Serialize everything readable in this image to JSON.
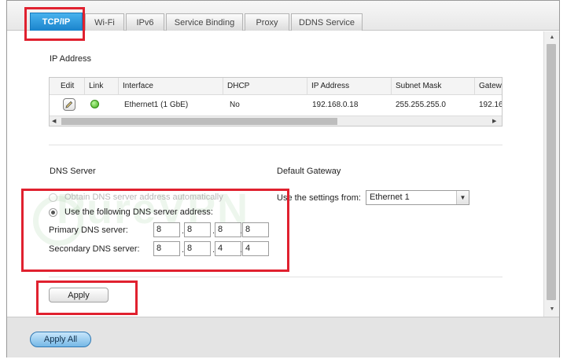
{
  "tabs": [
    {
      "label": "TCP/IP",
      "active": true
    },
    {
      "label": "Wi-Fi",
      "active": false
    },
    {
      "label": "IPv6",
      "active": false
    },
    {
      "label": "Service Binding",
      "active": false
    },
    {
      "label": "Proxy",
      "active": false
    },
    {
      "label": "DDNS Service",
      "active": false
    }
  ],
  "ip_section": {
    "title": "IP Address",
    "columns": [
      "Edit",
      "Link",
      "Interface",
      "DHCP",
      "IP Address",
      "Subnet Mask",
      "Gatewa"
    ],
    "rows": [
      {
        "edit_icon": "edit-pencil-icon",
        "link_status": "green",
        "interface": "Ethernet1 (1 GbE)",
        "dhcp": "No",
        "ip": "192.168.0.18",
        "subnet": "255.255.255.0",
        "gateway": "192.16"
      }
    ]
  },
  "dns": {
    "title": "DNS Server",
    "option_auto": "Obtain DNS server address automatically",
    "option_manual": "Use the following DNS server address:",
    "selected": "manual",
    "primary_label": "Primary DNS server:",
    "secondary_label": "Secondary DNS server:",
    "primary": [
      "8",
      "8",
      "8",
      "8"
    ],
    "secondary": [
      "8",
      "8",
      "4",
      "4"
    ]
  },
  "gateway": {
    "title": "Default Gateway",
    "label": "Use the settings from:",
    "selected": "Ethernet 1"
  },
  "buttons": {
    "apply": "Apply",
    "apply_all": "Apply All"
  },
  "watermark": "PureVPN",
  "colors": {
    "active_tab": "#1a84cc",
    "annotation": "#e0212f",
    "link_ok": "#3eab17"
  }
}
